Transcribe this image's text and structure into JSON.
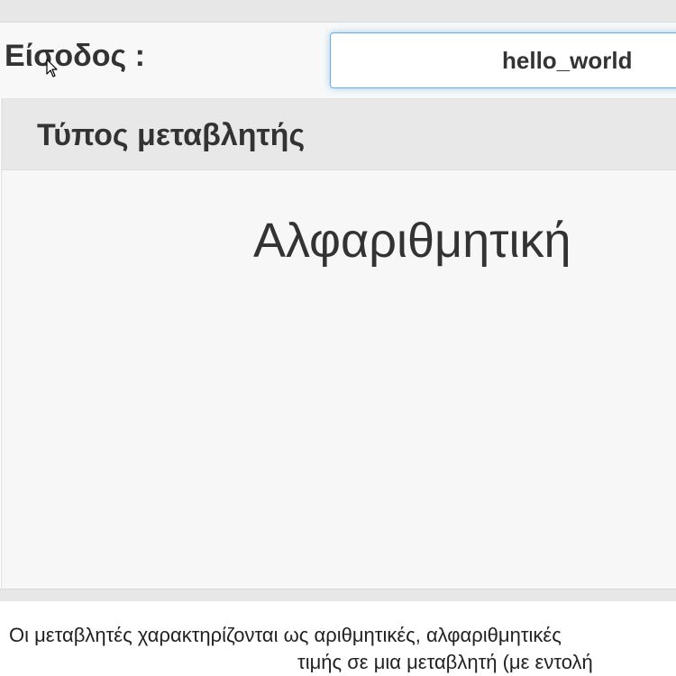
{
  "input": {
    "label": "Είσοδος :",
    "value": "hello_world"
  },
  "panel": {
    "title": "Τύπος μεταβλητής",
    "result": "Αλφαριθμητική"
  },
  "description": {
    "line1": "Οι μεταβλητές χαρακτηρίζονται ως αριθμητικές, αλφαριθμητικές",
    "line2": "τιμής σε μια μεταβλητή (με εντολή"
  },
  "icons": {
    "cursor": "mouse-pointer-icon"
  }
}
